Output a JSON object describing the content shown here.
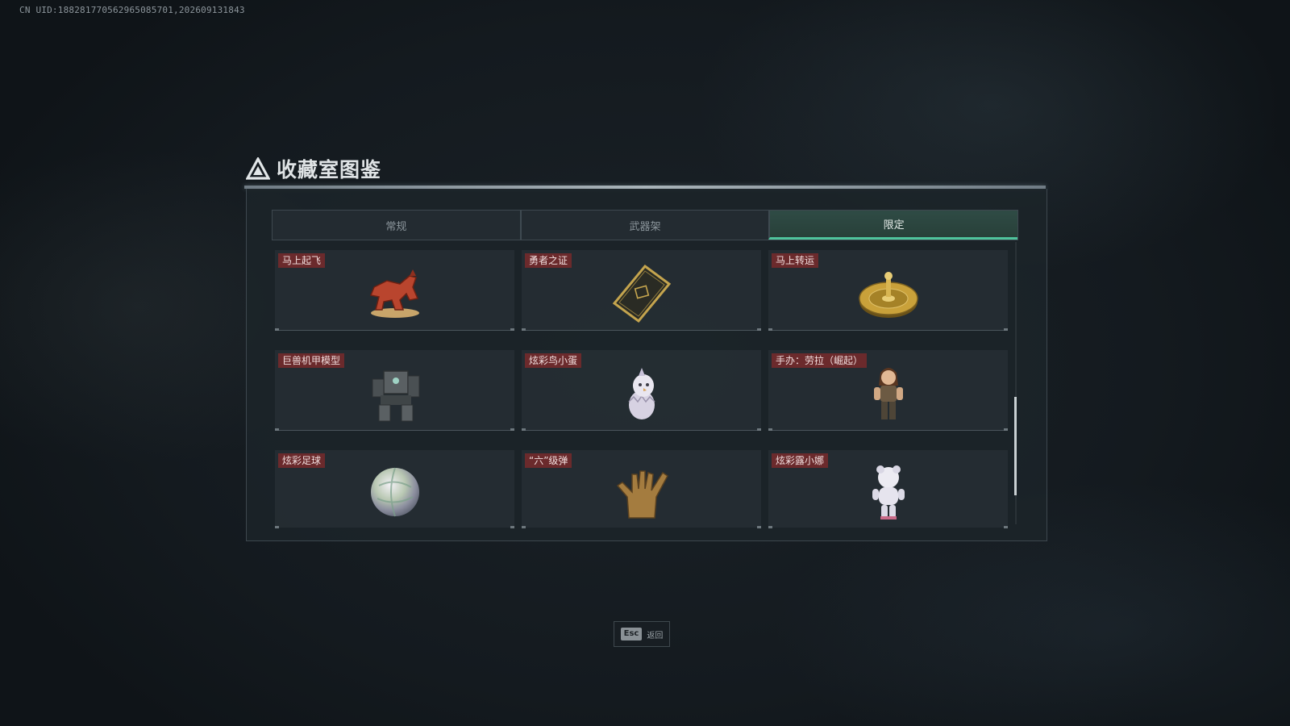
{
  "uid_text": "CN UID:188281770562965085701,202609131843",
  "title": "收藏室图鉴",
  "tabs": [
    {
      "label": "常规",
      "active": false
    },
    {
      "label": "武器架",
      "active": false
    },
    {
      "label": "限定",
      "active": true
    }
  ],
  "items": [
    {
      "name": "马上起飞",
      "icon": "red-horse-figurine-icon"
    },
    {
      "name": "勇者之证",
      "icon": "gold-card-icon"
    },
    {
      "name": "马上转运",
      "icon": "gold-roulette-icon"
    },
    {
      "name": "巨兽机甲模型",
      "icon": "mech-model-icon"
    },
    {
      "name": "炫彩鸟小蛋",
      "icon": "bird-egg-icon"
    },
    {
      "name": "手办：劳拉（崛起）",
      "icon": "lara-figure-icon"
    },
    {
      "name": "炫彩足球",
      "icon": "iridescent-ball-icon"
    },
    {
      "name": "“六”级弹",
      "icon": "golden-hand-icon"
    },
    {
      "name": "炫彩露小娜",
      "icon": "white-doll-icon"
    }
  ],
  "footer": {
    "key": "Esc",
    "label": "返回"
  },
  "colors": {
    "accent": "#4fc49c",
    "badge": "#6b2a2c"
  }
}
